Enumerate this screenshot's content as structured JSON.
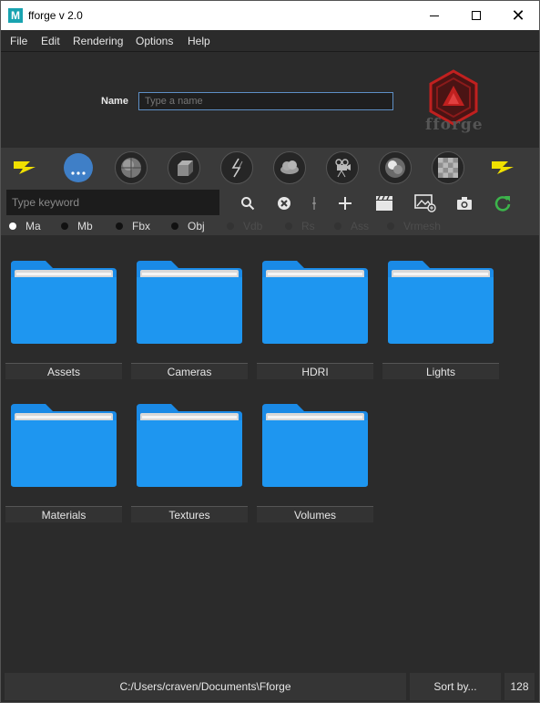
{
  "window": {
    "app_icon_letter": "M",
    "title": "fforge v 2.0",
    "minimize": "",
    "maximize": "",
    "close": "✕"
  },
  "menu": [
    "File",
    "Edit",
    "Rendering",
    "Options",
    "Help"
  ],
  "header": {
    "name_label": "Name",
    "name_placeholder": "Type a name",
    "name_value": "",
    "logo_text": "fforge"
  },
  "toolbar": {
    "tools": [
      {
        "name": "lightning-left-icon"
      },
      {
        "name": "more-dots-icon"
      },
      {
        "name": "sphere-icon"
      },
      {
        "name": "cube-icon"
      },
      {
        "name": "lightning-bolt-icon"
      },
      {
        "name": "cloud-icon"
      },
      {
        "name": "camera-rig-icon"
      },
      {
        "name": "color-balls-icon"
      },
      {
        "name": "texture-checker-icon"
      },
      {
        "name": "lightning-right-icon"
      }
    ]
  },
  "search": {
    "placeholder": "Type keyword",
    "value": "",
    "actions": [
      "search-icon",
      "clear-icon",
      "separator-icon",
      "add-icon",
      "clapper-icon",
      "image-add-icon",
      "snapshot-icon",
      "refresh-icon"
    ]
  },
  "formats": [
    {
      "label": "Ma",
      "selected": true,
      "enabled": true
    },
    {
      "label": "Mb",
      "selected": false,
      "enabled": true
    },
    {
      "label": "Fbx",
      "selected": false,
      "enabled": true
    },
    {
      "label": "Obj",
      "selected": false,
      "enabled": true
    },
    {
      "label": "Vdb",
      "selected": false,
      "enabled": false
    },
    {
      "label": "Rs",
      "selected": false,
      "enabled": false
    },
    {
      "label": "Ass",
      "selected": false,
      "enabled": false
    },
    {
      "label": "Vrmesh",
      "selected": false,
      "enabled": false
    }
  ],
  "folders": [
    "Assets",
    "Cameras",
    "HDRI",
    "Lights",
    "Materials",
    "Textures",
    "Volumes"
  ],
  "status": {
    "path": "C:/Users/craven/Documents\\Fforge",
    "sort": "Sort by...",
    "size": "128"
  },
  "colors": {
    "folder": "#1e96f0",
    "folder_back": "#1a8ae6",
    "accent_input": "#5e8fc6",
    "logo_red": "#c0201f",
    "lightning_yellow": "#f0e000",
    "refresh_green": "#3cb44b"
  }
}
